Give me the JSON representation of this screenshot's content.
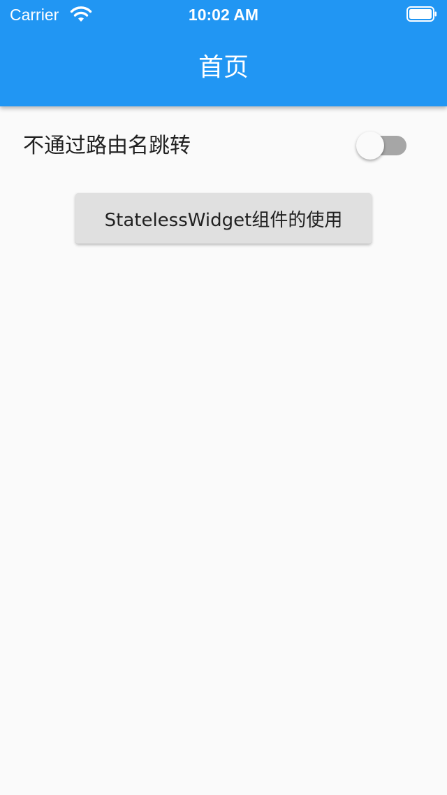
{
  "status_bar": {
    "carrier": "Carrier",
    "time": "10:02 AM",
    "wifi_icon": "wifi-icon",
    "battery_icon": "battery-icon"
  },
  "app_bar": {
    "title": "首页",
    "color": "#2196f3"
  },
  "route_toggle": {
    "label": "不通过路由名跳转",
    "checked": false
  },
  "stateless_button": {
    "label": "StatelessWidget组件的使用"
  }
}
